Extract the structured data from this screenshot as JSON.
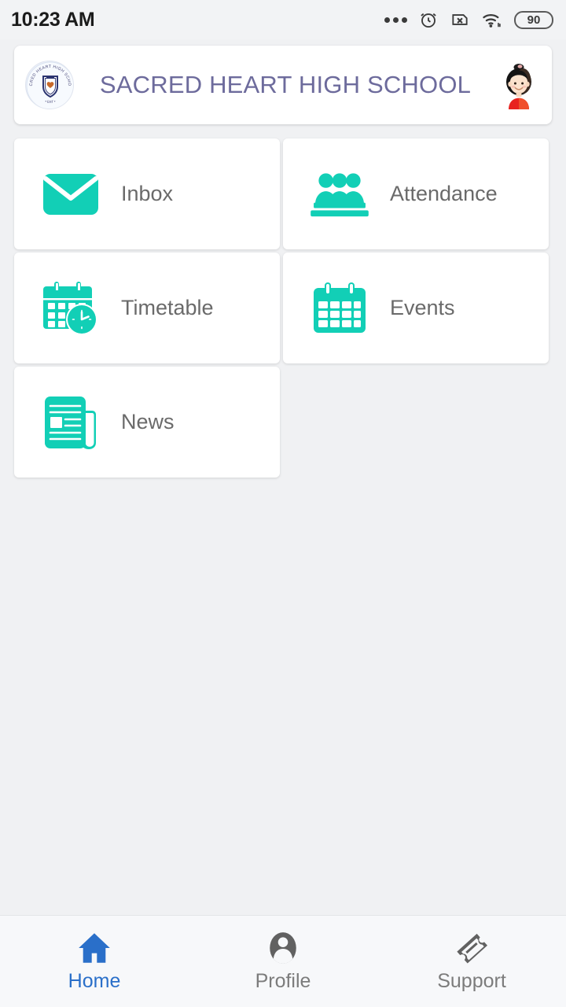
{
  "status_bar": {
    "time": "10:23 AM",
    "battery_level": "90",
    "icons": [
      "more-dots-icon",
      "alarm-clock-icon",
      "sim-disabled-icon",
      "wifi-icon",
      "battery-icon"
    ]
  },
  "header": {
    "school_name": "SACRED HEART HIGH SCHOOL",
    "crest_alt": "school-crest-icon",
    "crest_ring_text": "SACRED HEART HIGH SCHOOL",
    "avatar_alt": "student-avatar"
  },
  "tiles": [
    {
      "label": "Inbox",
      "icon": "envelope-icon"
    },
    {
      "label": "Attendance",
      "icon": "people-group-icon"
    },
    {
      "label": "Timetable",
      "icon": "calendar-clock-icon"
    },
    {
      "label": "Events",
      "icon": "calendar-icon"
    },
    {
      "label": "News",
      "icon": "newspaper-icon"
    }
  ],
  "bottom_nav": {
    "items": [
      {
        "label": "Home",
        "icon": "home-icon",
        "active": true
      },
      {
        "label": "Profile",
        "icon": "person-icon",
        "active": false
      },
      {
        "label": "Support",
        "icon": "ticket-icon",
        "active": false
      }
    ]
  },
  "colors": {
    "accent_teal": "#12cfb6",
    "title_purple": "#6d6b9c",
    "active_blue": "#2a6fc9",
    "label_gray": "#6a6a6a",
    "background": "#f0f1f3",
    "card": "#ffffff"
  }
}
